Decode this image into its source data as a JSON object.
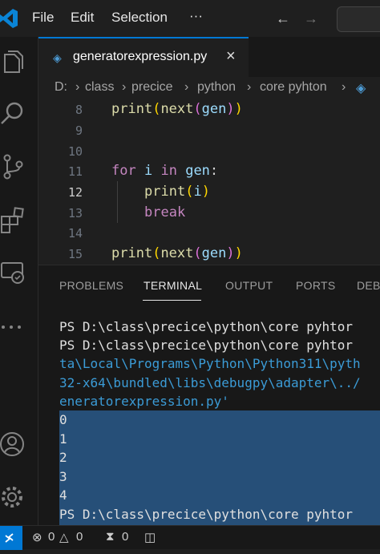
{
  "menu": {
    "file": "File",
    "edit": "Edit",
    "selection": "Selection",
    "more": "···"
  },
  "nav": {
    "back": "←",
    "forward": "→"
  },
  "tab": {
    "label": "generatorexpression.py",
    "close": "×"
  },
  "breadcrumb": [
    "D:",
    "class",
    "precice",
    "python",
    "core pyhton"
  ],
  "editor": {
    "lines": [
      {
        "num": "8",
        "code": "print(next(gen))"
      },
      {
        "num": "9",
        "code": ""
      },
      {
        "num": "10",
        "code": ""
      },
      {
        "num": "11",
        "code": "for i in gen:"
      },
      {
        "num": "12",
        "code": "print(i)"
      },
      {
        "num": "13",
        "code": "break"
      },
      {
        "num": "14",
        "code": ""
      },
      {
        "num": "15",
        "code": "print(next(gen))"
      }
    ],
    "tokens": {
      "print": "print",
      "next": "next",
      "gen": "gen",
      "for": "for",
      "i": "i",
      "in": "in",
      "break": "break",
      "lparen": "(",
      "rparen": ")",
      "rparen2": "))",
      "colon": ":"
    }
  },
  "panel": {
    "tabs": [
      "PROBLEMS",
      "TERMINAL",
      "OUTPUT",
      "PORTS",
      "DEBU"
    ],
    "terminal_lines": [
      "PS D:\\class\\precice\\python\\core pyhtor",
      "PS D:\\class\\precice\\python\\core pyhtor",
      "ta\\Local\\Programs\\Python\\Python311\\pyth",
      "32-x64\\bundled\\libs\\debugpy\\adapter\\../",
      "eneratorexpression.py'",
      "0",
      "1",
      "2",
      "3",
      "4",
      "PS D:\\class\\precice\\python\\core pyhtor"
    ]
  },
  "status": {
    "errors": "0",
    "warnings": "0",
    "ports": "0"
  },
  "colors": {
    "accent": "#0078d4",
    "keyword": "#c586c0",
    "function": "#dcdcaa",
    "variable": "#9cdcfe",
    "paren": "#ffd700",
    "selection": "#264f78",
    "terminal_path": "#3b9bd6"
  }
}
